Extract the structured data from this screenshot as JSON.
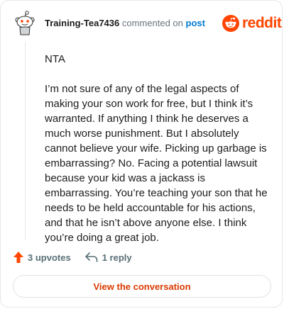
{
  "comment": {
    "username": "Training-Tea7436",
    "action_text": "commented on",
    "post_link": "post",
    "paragraphs": [
      "NTA",
      "I’m not sure of any of the legal aspects of making your son work for free, but I think it’s warranted. If anything I think he deserves a much worse punishment. But I absolutely cannot believe your wife. Picking up garbage is embarrassing? No. Facing a potential lawsuit because your kid was a jackass is embarrassing. You’re teaching your son that he needs to be held accountable for his actions, and that he isn’t above anyone else. I think you’re doing a great job."
    ]
  },
  "brand": {
    "name": "reddit",
    "color": "#ff4500",
    "icon": "reddit-snoo-icon"
  },
  "actions": {
    "upvotes_label": "3 upvotes",
    "replies_label": "1 reply"
  },
  "footer": {
    "button_label": "View the conversation"
  },
  "icons": {
    "avatar": "snoo-avatar-icon",
    "upvote": "upvote-arrow-icon",
    "reply": "reply-arrow-icon"
  },
  "colors": {
    "accent": "#ff4500",
    "link": "#0079d3",
    "button_text": "#d93a00",
    "meta_text": "#576f76"
  }
}
